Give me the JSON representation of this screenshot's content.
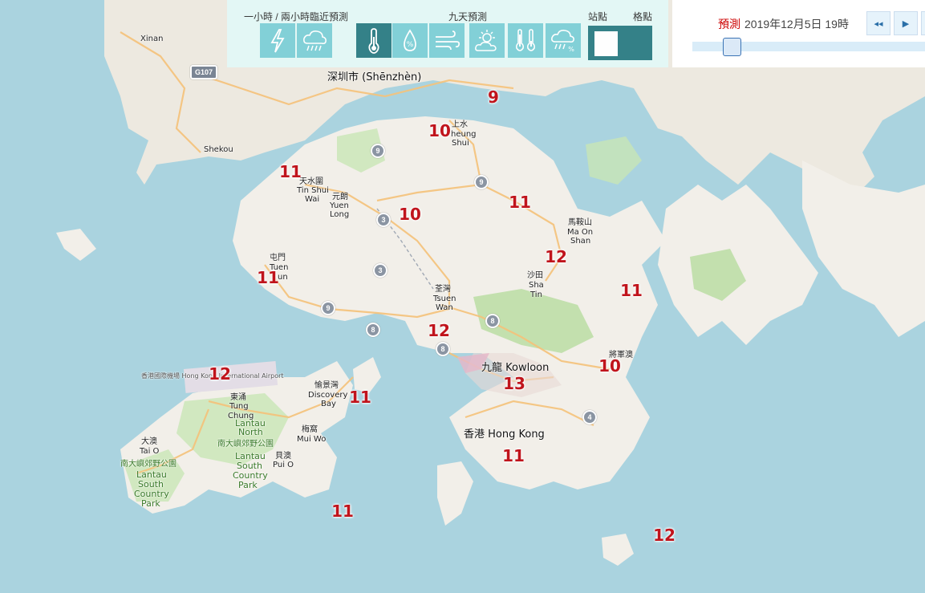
{
  "toolbar": {
    "nowcast_label": "一小時 / 兩小時臨近預測",
    "nineday_label": "九天預測",
    "station_label": "站點",
    "grid_label": "格點",
    "buttons": [
      {
        "icon": "lightning-icon"
      },
      {
        "icon": "rain-cloud-icon"
      },
      {
        "icon": "thermometer-icon",
        "selected": true
      },
      {
        "icon": "humidity-icon"
      },
      {
        "icon": "wind-icon"
      },
      {
        "icon": "sun-cloud-icon"
      },
      {
        "icon": "max-min-temperature-icon"
      },
      {
        "icon": "rain-probability-icon"
      }
    ]
  },
  "timepanel": {
    "forecast_label": "預測",
    "datetime": "2019年12月5日 19時",
    "prev_label": "◂◂",
    "play_label": "▶"
  },
  "map": {
    "place_labels": [
      {
        "text": "Xinan"
      },
      {
        "text": "深圳市 (Shēnzhèn)"
      },
      {
        "text": "上水"
      },
      {
        "text": "heung"
      },
      {
        "text": "Shui"
      },
      {
        "text": "Shekou"
      },
      {
        "text": "天水圍"
      },
      {
        "text": "Tin Shui"
      },
      {
        "text": "Wai"
      },
      {
        "text": "元朗"
      },
      {
        "text": "Yuen"
      },
      {
        "text": "Long"
      },
      {
        "text": "屯門"
      },
      {
        "text": "Tuen"
      },
      {
        "text": "un"
      },
      {
        "text": "馬鞍山"
      },
      {
        "text": "Ma On"
      },
      {
        "text": "Shan"
      },
      {
        "text": "沙田"
      },
      {
        "text": "Sha"
      },
      {
        "text": "Tin"
      },
      {
        "text": "荃灣"
      },
      {
        "text": "Tsuen"
      },
      {
        "text": "Wan"
      },
      {
        "text": "將軍澳"
      },
      {
        "text": "九龍 Kowloon"
      },
      {
        "text": "香港 Hong Kong"
      },
      {
        "text": "愉景灣"
      },
      {
        "text": "Discovery"
      },
      {
        "text": "Bay"
      },
      {
        "text": "東涌"
      },
      {
        "text": "Tung"
      },
      {
        "text": "Chung"
      },
      {
        "text": "梅窩"
      },
      {
        "text": "Mui Wo"
      },
      {
        "text": "大澳"
      },
      {
        "text": "Tai O"
      },
      {
        "text": "南大嶼郊野公園"
      },
      {
        "text": "Lantau"
      },
      {
        "text": "North"
      },
      {
        "text": "Lantau"
      },
      {
        "text": "South"
      },
      {
        "text": "Country"
      },
      {
        "text": "Park"
      },
      {
        "text": "南大嶼郊野公園"
      },
      {
        "text": "Lantau"
      },
      {
        "text": "South"
      },
      {
        "text": "Country"
      },
      {
        "text": "Park"
      },
      {
        "text": "貝澳"
      },
      {
        "text": "Pui O"
      },
      {
        "text": "香港國際機場 Hong Kong International Airport"
      }
    ],
    "route_shields": [
      "G107",
      "9",
      "9",
      "3",
      "3",
      "9",
      "8",
      "8",
      "8",
      "4"
    ],
    "temperatures": [
      {
        "value": "9"
      },
      {
        "value": "10"
      },
      {
        "value": "11"
      },
      {
        "value": "10"
      },
      {
        "value": "11"
      },
      {
        "value": "11"
      },
      {
        "value": "12"
      },
      {
        "value": "11"
      },
      {
        "value": "12"
      },
      {
        "value": "12"
      },
      {
        "value": "11"
      },
      {
        "value": "10"
      },
      {
        "value": "13"
      },
      {
        "value": "11"
      },
      {
        "value": "11"
      },
      {
        "value": "12"
      }
    ]
  },
  "colors": {
    "sea": "#aad3df",
    "land": "#f2efe9",
    "park": "#c8e6b5",
    "temperature_text": "#c0141c",
    "button": "#7fd0d7",
    "button_selected": "#2f7e86"
  }
}
